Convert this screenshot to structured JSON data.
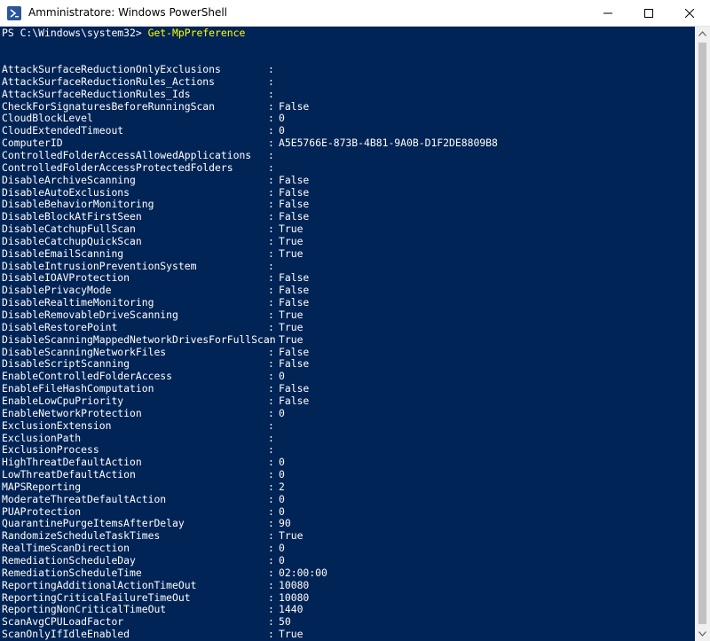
{
  "window": {
    "title": "Amministratore: Windows PowerShell",
    "icon": "powershell-icon",
    "controls": [
      "minimize-icon",
      "maximize-icon",
      "close-icon"
    ]
  },
  "console": {
    "prompt": "PS C:\\Windows\\system32> ",
    "command": "Get-MpPreference",
    "colors": {
      "background": "#012456",
      "text": "#ffffff",
      "command": "#ffff00"
    },
    "rows": [
      {
        "key": "AttackSurfaceReductionOnlyExclusions",
        "value": ""
      },
      {
        "key": "AttackSurfaceReductionRules_Actions",
        "value": ""
      },
      {
        "key": "AttackSurfaceReductionRules_Ids",
        "value": ""
      },
      {
        "key": "CheckForSignaturesBeforeRunningScan",
        "value": "False"
      },
      {
        "key": "CloudBlockLevel",
        "value": "0"
      },
      {
        "key": "CloudExtendedTimeout",
        "value": "0"
      },
      {
        "key": "ComputerID",
        "value": "A5E5766E-873B-4B81-9A0B-D1F2DE8809B8"
      },
      {
        "key": "ControlledFolderAccessAllowedApplications",
        "value": ""
      },
      {
        "key": "ControlledFolderAccessProtectedFolders",
        "value": ""
      },
      {
        "key": "DisableArchiveScanning",
        "value": "False"
      },
      {
        "key": "DisableAutoExclusions",
        "value": "False"
      },
      {
        "key": "DisableBehaviorMonitoring",
        "value": "False"
      },
      {
        "key": "DisableBlockAtFirstSeen",
        "value": "False"
      },
      {
        "key": "DisableCatchupFullScan",
        "value": "True"
      },
      {
        "key": "DisableCatchupQuickScan",
        "value": "True"
      },
      {
        "key": "DisableEmailScanning",
        "value": "True"
      },
      {
        "key": "DisableIntrusionPreventionSystem",
        "value": ""
      },
      {
        "key": "DisableIOAVProtection",
        "value": "False"
      },
      {
        "key": "DisablePrivacyMode",
        "value": "False"
      },
      {
        "key": "DisableRealtimeMonitoring",
        "value": "False"
      },
      {
        "key": "DisableRemovableDriveScanning",
        "value": "True"
      },
      {
        "key": "DisableRestorePoint",
        "value": "True"
      },
      {
        "key": "DisableScanningMappedNetworkDrivesForFullScan",
        "value": "True"
      },
      {
        "key": "DisableScanningNetworkFiles",
        "value": "False"
      },
      {
        "key": "DisableScriptScanning",
        "value": "False"
      },
      {
        "key": "EnableControlledFolderAccess",
        "value": "0"
      },
      {
        "key": "EnableFileHashComputation",
        "value": "False"
      },
      {
        "key": "EnableLowCpuPriority",
        "value": "False"
      },
      {
        "key": "EnableNetworkProtection",
        "value": "0"
      },
      {
        "key": "ExclusionExtension",
        "value": ""
      },
      {
        "key": "ExclusionPath",
        "value": ""
      },
      {
        "key": "ExclusionProcess",
        "value": ""
      },
      {
        "key": "HighThreatDefaultAction",
        "value": "0"
      },
      {
        "key": "LowThreatDefaultAction",
        "value": "0"
      },
      {
        "key": "MAPSReporting",
        "value": "2"
      },
      {
        "key": "ModerateThreatDefaultAction",
        "value": "0"
      },
      {
        "key": "PUAProtection",
        "value": "0"
      },
      {
        "key": "QuarantinePurgeItemsAfterDelay",
        "value": "90"
      },
      {
        "key": "RandomizeScheduleTaskTimes",
        "value": "True"
      },
      {
        "key": "RealTimeScanDirection",
        "value": "0"
      },
      {
        "key": "RemediationScheduleDay",
        "value": "0"
      },
      {
        "key": "RemediationScheduleTime",
        "value": "02:00:00"
      },
      {
        "key": "ReportingAdditionalActionTimeOut",
        "value": "10080"
      },
      {
        "key": "ReportingCriticalFailureTimeOut",
        "value": "10080"
      },
      {
        "key": "ReportingNonCriticalTimeOut",
        "value": "1440"
      },
      {
        "key": "ScanAvgCPULoadFactor",
        "value": "50"
      },
      {
        "key": "ScanOnlyIfIdleEnabled",
        "value": "True"
      }
    ]
  }
}
